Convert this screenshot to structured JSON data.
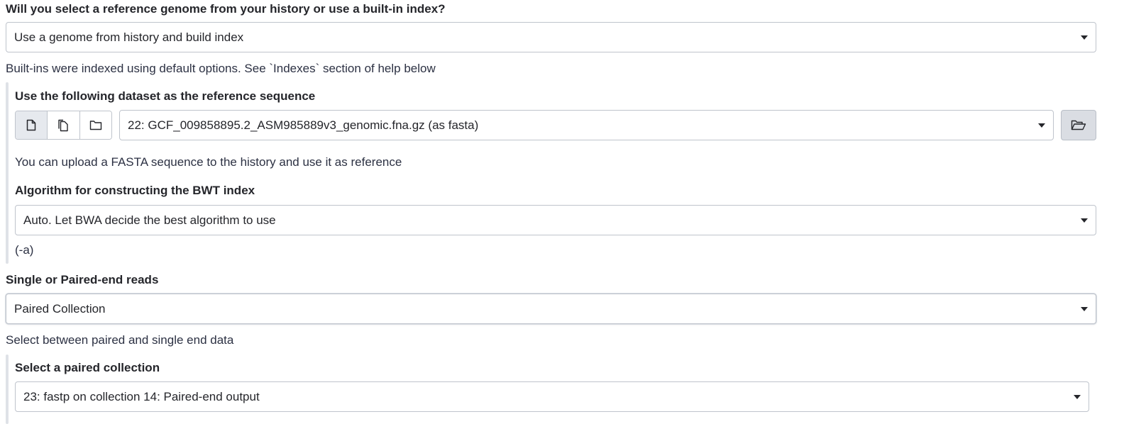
{
  "reference": {
    "question_label": "Will you select a reference genome from your history or use a built-in index?",
    "source_select_value": "Use a genome from history and build index",
    "source_help": "Built-ins were indexed using default options. See `Indexes` section of help below",
    "dataset_label": "Use the following dataset as the reference sequence",
    "dataset_select_value": "22: GCF_009858895.2_ASM985889v3_genomic.fna.gz (as fasta)",
    "dataset_buttons": [
      {
        "icon": "file-icon",
        "active": true
      },
      {
        "icon": "files-icon",
        "active": false
      },
      {
        "icon": "folder-icon",
        "active": false
      }
    ],
    "browse_icon": "folder-open-icon",
    "dataset_help": "You can upload a FASTA sequence to the history and use it as reference",
    "algorithm_label": "Algorithm for constructing the BWT index",
    "algorithm_select_value": "Auto. Let BWA decide the best algorithm to use",
    "algorithm_help": "(-a)"
  },
  "reads": {
    "mode_label": "Single or Paired-end reads",
    "mode_select_value": "Paired Collection",
    "mode_help": "Select between paired and single end data",
    "collection_label": "Select a paired collection",
    "collection_select_value": "23: fastp on collection 14: Paired-end output"
  }
}
